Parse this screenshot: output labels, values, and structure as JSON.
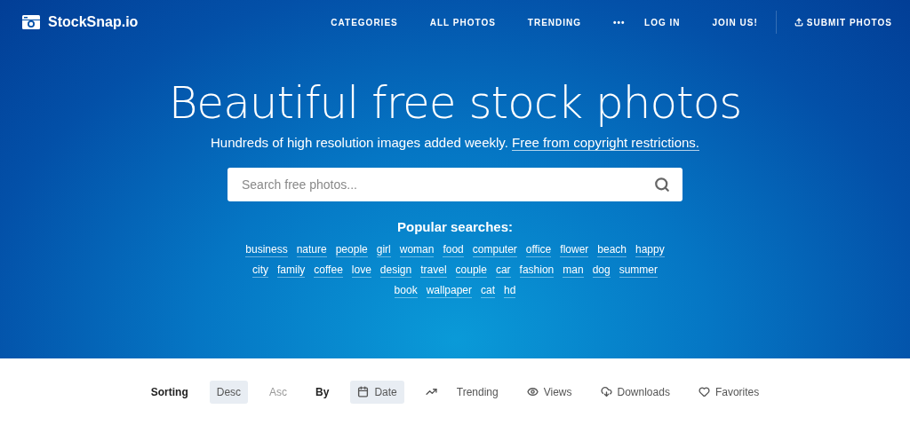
{
  "brand": "StockSnap.io",
  "nav": [
    "CATEGORIES",
    "ALL PHOTOS",
    "TRENDING",
    "•••"
  ],
  "account": [
    "LOG IN",
    "JOIN US!"
  ],
  "submit": "SUBMIT PHOTOS",
  "hero": {
    "title": "Beautiful free stock photos",
    "subtitle": "Hundreds of high resolution images added weekly.",
    "subtitle_link": "Free from copyright restrictions."
  },
  "search": {
    "placeholder": "Search free photos..."
  },
  "popular": {
    "heading": "Popular searches:",
    "tags": [
      "business",
      "nature",
      "people",
      "girl",
      "woman",
      "food",
      "computer",
      "office",
      "flower",
      "beach",
      "happy",
      "city",
      "family",
      "coffee",
      "love",
      "design",
      "travel",
      "couple",
      "car",
      "fashion",
      "man",
      "dog",
      "summer",
      "book",
      "wallpaper",
      "cat",
      "hd"
    ]
  },
  "sorting": {
    "label": "Sorting",
    "orders": [
      {
        "label": "Desc",
        "selected": true
      },
      {
        "label": "Asc",
        "selected": false
      }
    ],
    "by_label": "By",
    "fields": [
      {
        "label": "Date",
        "selected": true
      },
      {
        "label": "Trending",
        "selected": false
      },
      {
        "label": "Views",
        "selected": false
      },
      {
        "label": "Downloads",
        "selected": false
      },
      {
        "label": "Favorites",
        "selected": false
      }
    ]
  }
}
